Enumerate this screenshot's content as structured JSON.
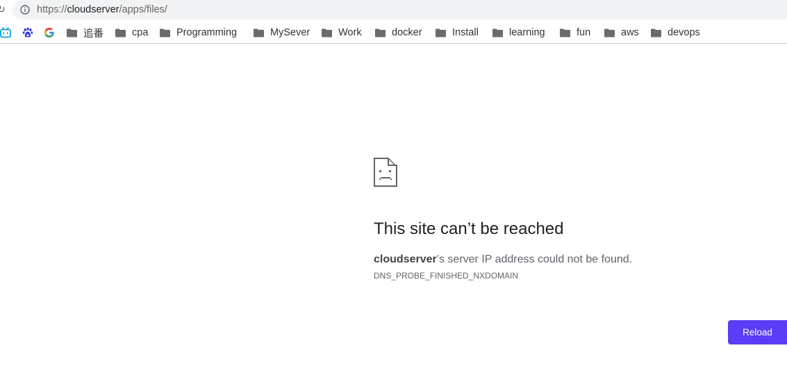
{
  "browser": {
    "url_scheme": "https://",
    "url_host": "cloudserver",
    "url_path": "/apps/files/"
  },
  "bookmarks": {
    "icons": [
      "bilibili-icon",
      "baidu-icon",
      "google-icon"
    ],
    "folders": [
      "追番",
      "cpa",
      "Programming",
      "MySever",
      "Work",
      "docker",
      "Install",
      "learning",
      "fun",
      "aws",
      "devops"
    ]
  },
  "error": {
    "title": "This site can’t be reached",
    "host": "cloudserver",
    "message_rest": "’s server IP address could not be found.",
    "code": "DNS_PROBE_FINISHED_NXDOMAIN",
    "reload_label": "Reload"
  },
  "colors": {
    "accent": "#5b3df5",
    "omnibox_bg": "#f1f3f4"
  }
}
